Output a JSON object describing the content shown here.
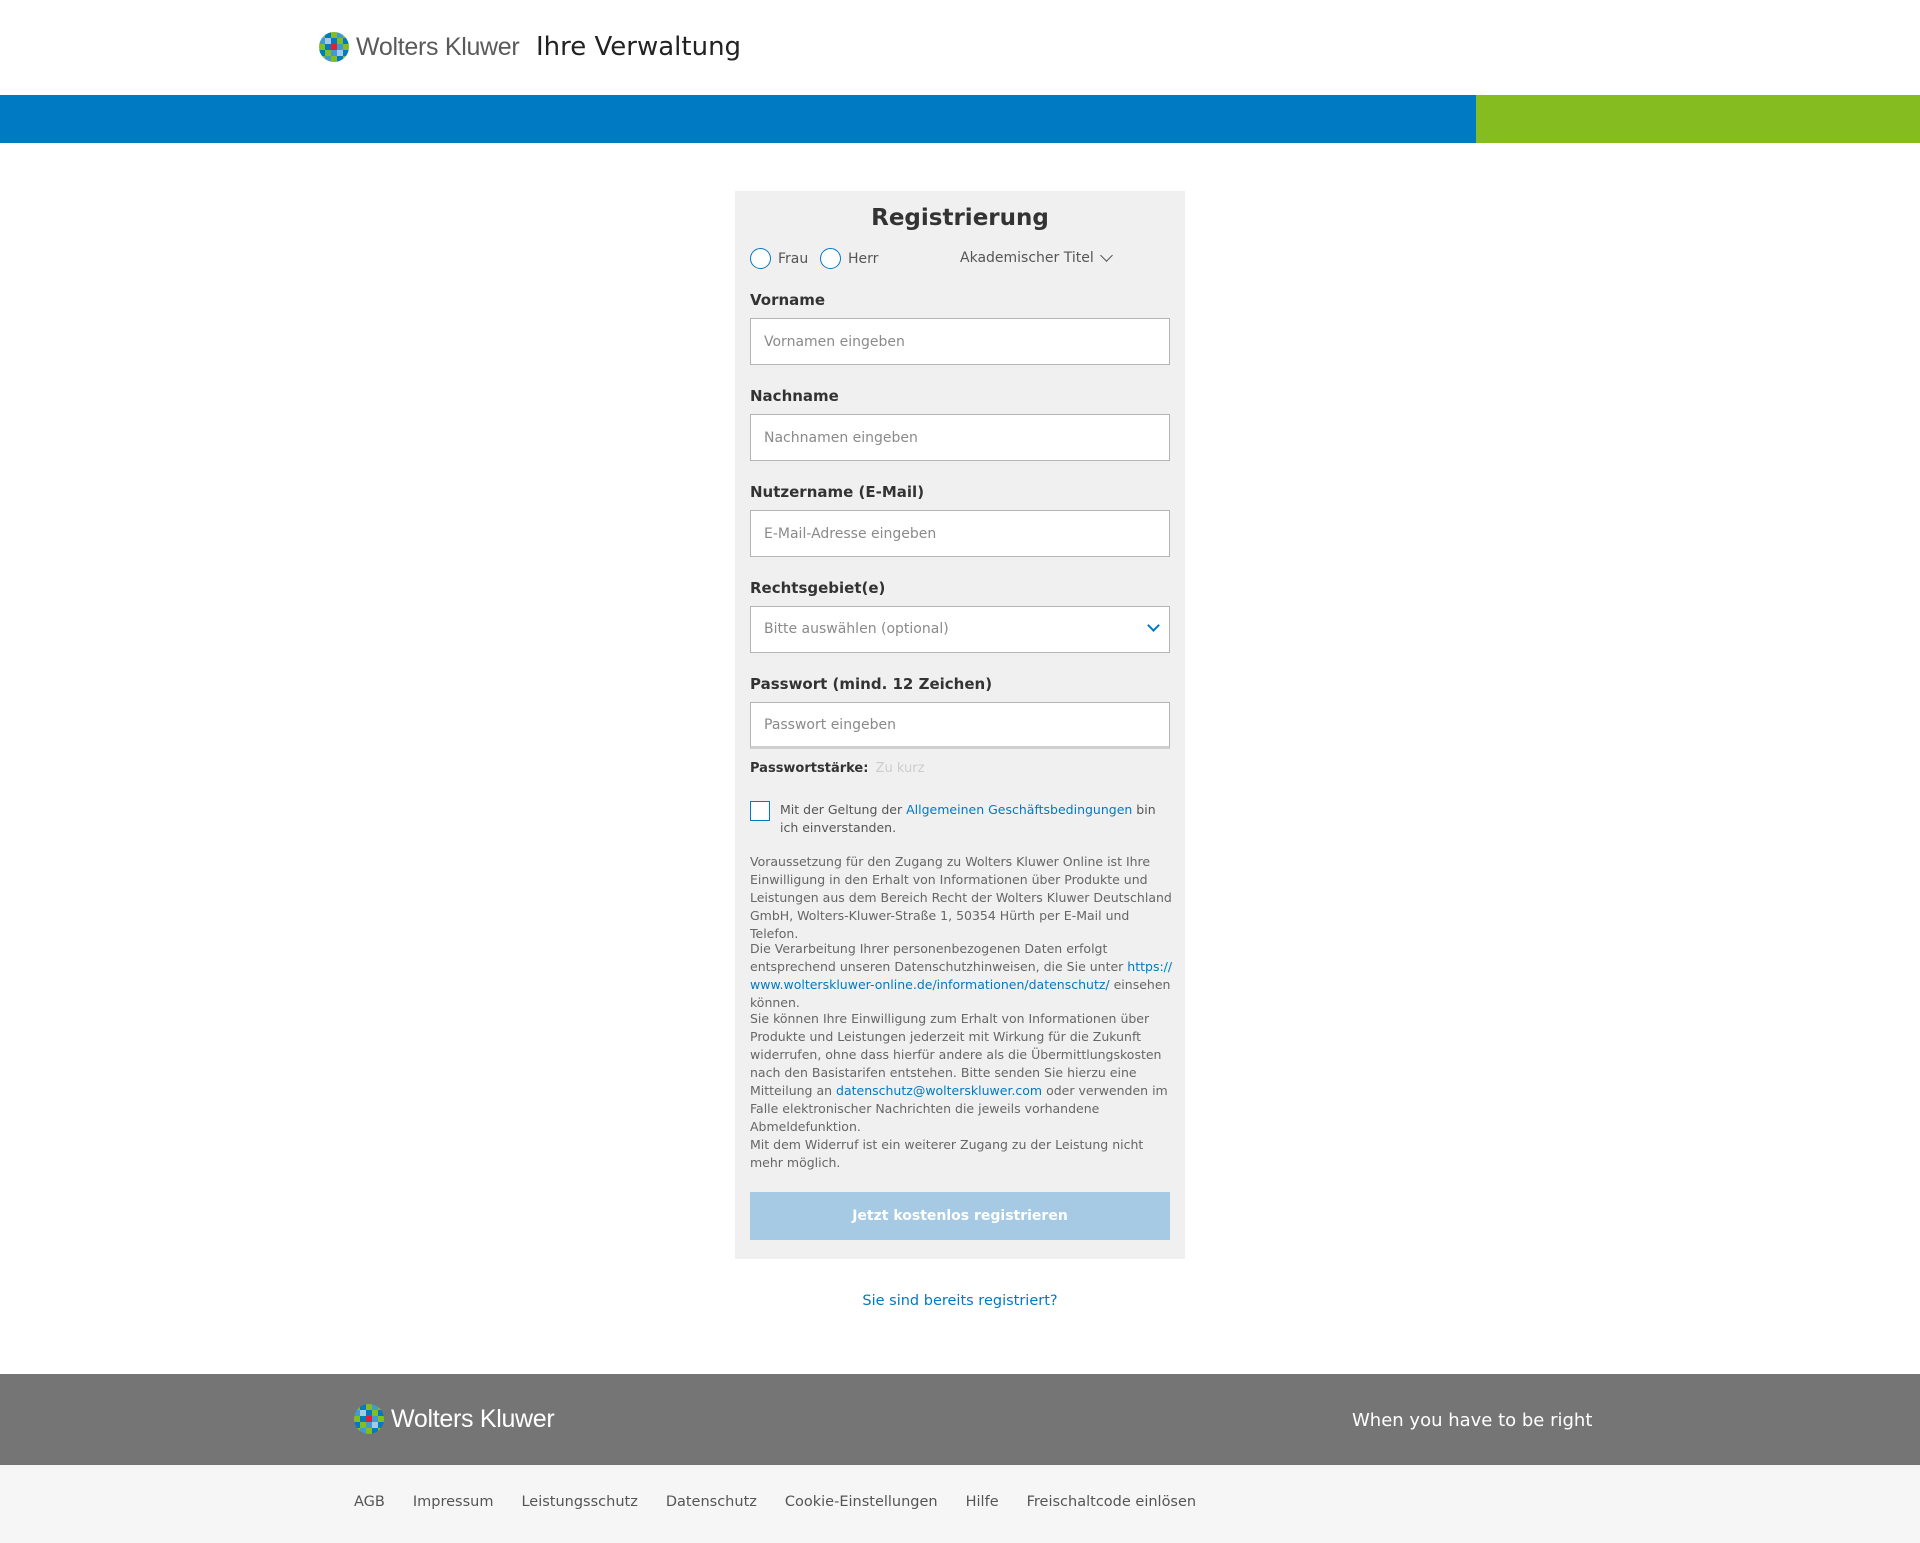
{
  "header": {
    "logo_text": "Wolters Kluwer",
    "app_title": "Ihre Verwaltung"
  },
  "colors": {
    "brand_blue": "#007ac3",
    "brand_green": "#85bc20",
    "footer_dark": "#757575",
    "submit_disabled": "#a6cae3"
  },
  "form": {
    "title": "Registrierung",
    "salutation": {
      "options": [
        "Frau",
        "Herr"
      ],
      "academic_title_label": "Akademischer Titel"
    },
    "firstname": {
      "label": "Vorname",
      "placeholder": "Vornamen eingeben"
    },
    "lastname": {
      "label": "Nachname",
      "placeholder": "Nachnamen eingeben"
    },
    "username": {
      "label": "Nutzername (E-Mail)",
      "placeholder": "E-Mail-Adresse eingeben"
    },
    "legal_areas": {
      "label": "Rechtsgebiet(e)",
      "placeholder": "Bitte auswählen (optional)"
    },
    "password": {
      "label": "Passwort (mind. 12 Zeichen)",
      "placeholder": "Passwort eingeben"
    },
    "password_strength": {
      "label": "Passwortstärke:",
      "value": "Zu kurz"
    },
    "terms": {
      "prefix": "Mit der Geltung der ",
      "link": "Allgemeinen Geschäftsbedingungen",
      "suffix": " bin ich einverstanden."
    },
    "consent_text": "Voraussetzung für den Zugang zu Wolters Kluwer Online ist Ihre Einwilligung in den Erhalt von Informationen über Produkte und Leistungen aus dem Bereich Recht der Wolters Kluwer Deutschland GmbH, Wolters-Kluwer-Straße 1, 50354 Hürth per E-Mail und Telefon.",
    "privacy": {
      "prefix": "Die Verarbeitung Ihrer personenbezogenen Daten erfolgt entsprechend unseren Datenschutzhinweisen, die Sie unter ",
      "link": "https://www.wolterskluwer-online.de/informationen/datenschutz/",
      "suffix": " einsehen können."
    },
    "revoke": {
      "prefix": "Sie können Ihre Einwilligung zum Erhalt von Informationen über Produkte und Leistungen jederzeit mit Wirkung für die Zukunft widerrufen, ohne dass hierfür andere als die Übermittlungskosten nach den Basistarifen entstehen. Bitte senden Sie hierzu eine Mitteilung an ",
      "link": "datenschutz@wolterskluwer.com",
      "suffix": " oder verwenden im Falle elektronischer Nachrichten die jeweils vorhandene Abmeldefunktion."
    },
    "revoke_note": "Mit dem Widerruf ist ein weiterer Zugang zu der Leistung nicht mehr möglich.",
    "submit_label": "Jetzt kostenlos registrieren"
  },
  "already_registered": "Sie sind bereits registriert?",
  "footer": {
    "logo_text": "Wolters Kluwer",
    "tagline": "When you have to be right",
    "links": [
      "AGB",
      "Impressum",
      "Leistungsschutz",
      "Datenschutz",
      "Cookie-Einstellungen",
      "Hilfe",
      "Freischaltcode einlösen"
    ]
  }
}
